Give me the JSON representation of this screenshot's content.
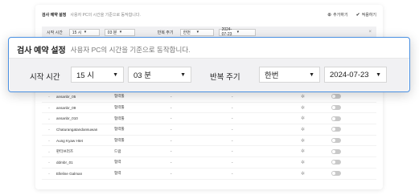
{
  "background": {
    "title": "검사 예약 설정",
    "subtitle": "사용자 PC의 시간을 기준으로 동작합니다.",
    "actions": [
      {
        "icon": "plus-circle-icon",
        "glyph": "⊕",
        "label": "추가하기"
      },
      {
        "icon": "check-circle-icon",
        "glyph": "✔",
        "label": "적용하기"
      }
    ],
    "bar": {
      "start_label": "시작 시간",
      "hour": "15 시",
      "minute": "03 분",
      "repeat_label": "반복 주기",
      "repeat": "한번",
      "date": "2024-07-23",
      "close": "×"
    },
    "rows": [
      {
        "name": "ansanbr_05",
        "role": "협력툴",
        "d1": "-",
        "d2": "-"
      },
      {
        "name": "ansanbr_09",
        "role": "협력툴",
        "d1": "-",
        "d2": "-"
      },
      {
        "name": "ansanbr_010",
        "role": "협력툴",
        "d1": "-",
        "d2": "-"
      },
      {
        "name": "Chaturangatandansuwan",
        "role": "협력툴",
        "d1": "-",
        "d2": "-"
      },
      {
        "name": "Aung Kyaw Htet",
        "role": "협력툴",
        "d1": "-",
        "d2": "-"
      },
      {
        "name": "판터브러즈",
        "role": "드럼",
        "d1": "-",
        "d2": "-"
      },
      {
        "name": "ddmbr_01",
        "role": "협력",
        "d1": "-",
        "d2": "-"
      },
      {
        "name": "Elleline Galman",
        "role": "협력",
        "d1": "-",
        "d2": "-"
      }
    ]
  },
  "modal": {
    "title": "검사 예약 설정",
    "subtitle": "사용자 PC의 시간을 기준으로 동작합니다.",
    "start_label": "시작 시간",
    "hour": "15 시",
    "minute": "03 분",
    "repeat_label": "반복 주기",
    "repeat": "한번",
    "date": "2024-07-23"
  },
  "colors": {
    "accent": "#4a90e2",
    "bar_bg": "#f1f1f3"
  }
}
